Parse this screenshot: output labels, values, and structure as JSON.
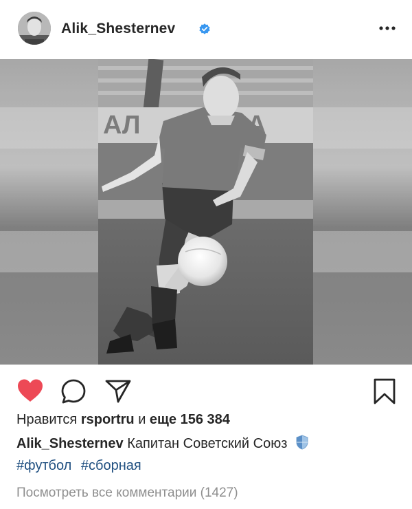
{
  "post": {
    "username": "Alik_Shesternev",
    "verified": true
  },
  "actions": {
    "like_icon": "heart-filled-icon",
    "comment_icon": "comment-bubble-icon",
    "share_icon": "paper-plane-icon",
    "save_icon": "bookmark-icon",
    "like_color": "#ed4956"
  },
  "likes": {
    "prefix": "Нравится",
    "user": "rsportru",
    "connector": "и",
    "more_label": "еще",
    "count": "156 384"
  },
  "caption": {
    "username": "Alik_Shesternev",
    "text": "Капитан Советский Союз",
    "emoji": "shield-icon"
  },
  "hashtags": [
    "#футбол",
    "#сборная"
  ],
  "comments": {
    "label": "Посмотреть все комментарии",
    "count_text": "(1427)"
  },
  "colors": {
    "link": "#1f4f80",
    "muted": "#8e8e8e",
    "verified": "#3897f0"
  }
}
